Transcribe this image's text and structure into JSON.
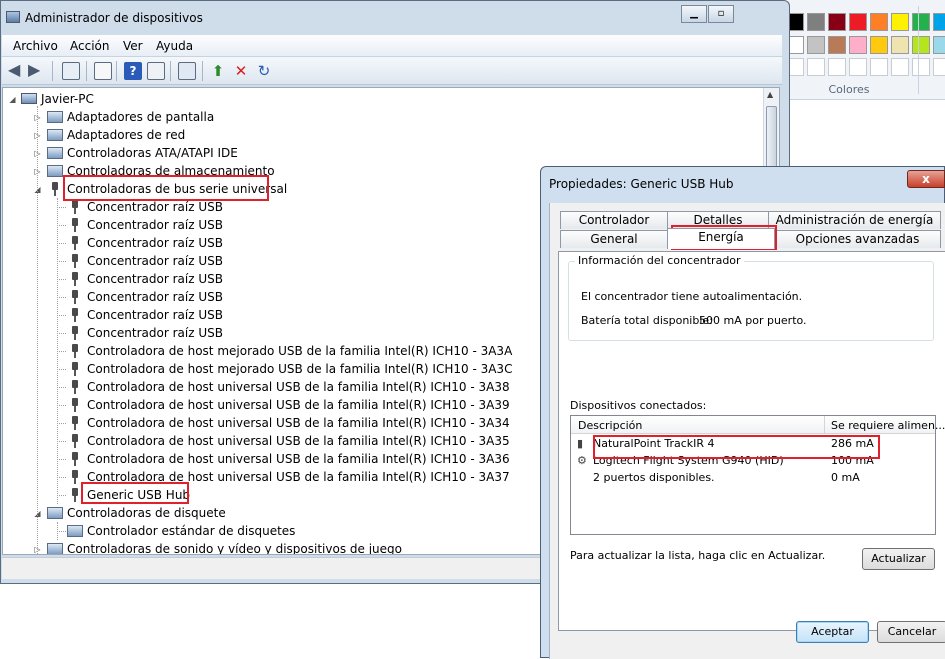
{
  "paint": {
    "colors_label": "Colores",
    "swatches_row1": [
      "#000000",
      "#7f7f7f",
      "#880015",
      "#ed1c24",
      "#ff7f27",
      "#fff200",
      "#22b14c",
      "#00a2e8"
    ],
    "swatches_row2": [
      "#ffffff",
      "#c3c3c3",
      "#b97a57",
      "#ffaec9",
      "#ffc90e",
      "#efe4b0",
      "#b5e61d",
      "#99d9ea"
    ]
  },
  "device_manager": {
    "title": "Administrador de dispositivos",
    "menu": [
      "Archivo",
      "Acción",
      "Ver",
      "Ayuda"
    ],
    "root": "Javier-PC",
    "tree": [
      {
        "label": "Adaptadores de pantalla",
        "level": 1,
        "icon": "monitor-icon",
        "expanded": false
      },
      {
        "label": "Adaptadores de red",
        "level": 1,
        "icon": "network-icon",
        "expanded": false
      },
      {
        "label": "Controladoras ATA/ATAPI IDE",
        "level": 1,
        "icon": "ide-icon",
        "expanded": false
      },
      {
        "label": "Controladoras de almacenamiento",
        "level": 1,
        "icon": "storage-icon",
        "expanded": false
      },
      {
        "label": "Controladoras de bus serie universal",
        "level": 1,
        "icon": "usb-icon",
        "expanded": true
      },
      {
        "label": "Concentrador raíz USB",
        "level": 2,
        "icon": "usb-icon"
      },
      {
        "label": "Concentrador raíz USB",
        "level": 2,
        "icon": "usb-icon"
      },
      {
        "label": "Concentrador raíz USB",
        "level": 2,
        "icon": "usb-icon"
      },
      {
        "label": "Concentrador raíz USB",
        "level": 2,
        "icon": "usb-icon"
      },
      {
        "label": "Concentrador raíz USB",
        "level": 2,
        "icon": "usb-icon"
      },
      {
        "label": "Concentrador raíz USB",
        "level": 2,
        "icon": "usb-icon"
      },
      {
        "label": "Concentrador raíz USB",
        "level": 2,
        "icon": "usb-icon"
      },
      {
        "label": "Concentrador raíz USB",
        "level": 2,
        "icon": "usb-icon"
      },
      {
        "label": "Controladora de host mejorado USB de la familia Intel(R) ICH10 - 3A3A",
        "level": 2,
        "icon": "usb-icon"
      },
      {
        "label": "Controladora de host mejorado USB de la familia Intel(R) ICH10 - 3A3C",
        "level": 2,
        "icon": "usb-icon"
      },
      {
        "label": "Controladora de host universal USB de la familia Intel(R) ICH10 - 3A38",
        "level": 2,
        "icon": "usb-icon"
      },
      {
        "label": "Controladora de host universal USB de la familia Intel(R) ICH10 - 3A39",
        "level": 2,
        "icon": "usb-icon"
      },
      {
        "label": "Controladora de host universal USB de la familia Intel(R) ICH10 - 3A34",
        "level": 2,
        "icon": "usb-icon"
      },
      {
        "label": "Controladora de host universal USB de la familia Intel(R) ICH10 - 3A35",
        "level": 2,
        "icon": "usb-icon"
      },
      {
        "label": "Controladora de host universal USB de la familia Intel(R) ICH10 - 3A36",
        "level": 2,
        "icon": "usb-icon"
      },
      {
        "label": "Controladora de host universal USB de la familia Intel(R) ICH10 - 3A37",
        "level": 2,
        "icon": "usb-icon"
      },
      {
        "label": "Generic USB Hub",
        "level": 2,
        "icon": "usb-icon"
      },
      {
        "label": "Controladoras de disquete",
        "level": 1,
        "icon": "floppy-controller-icon",
        "expanded": true
      },
      {
        "label": "Controlador estándar de disquetes",
        "level": 2,
        "icon": "floppy-icon"
      },
      {
        "label": "Controladoras de sonido y vídeo y dispositivos de juego",
        "level": 1,
        "icon": "sound-icon",
        "expanded": false
      }
    ]
  },
  "properties": {
    "title": "Propiedades: Generic USB Hub",
    "close_label": "x",
    "tabs_row1": [
      "Controlador",
      "Detalles",
      "Administración de energía"
    ],
    "tabs_row2": [
      "General",
      "Energía",
      "Opciones avanzadas"
    ],
    "hub_group_title": "Información del concentrador",
    "self_powered_text": "El concentrador tiene autoalimentación.",
    "battery_label": "Batería total disponible:",
    "battery_value": "500 mA por puerto.",
    "connected_label": "Dispositivos conectados:",
    "columns": [
      "Descripción",
      "Se requiere alimen..."
    ],
    "devices": [
      {
        "name": "NaturalPoint TrackIR 4",
        "power": "286 mA",
        "icon": "usb-plug-icon"
      },
      {
        "name": "Logitech Flight System G940 (HID)",
        "power": "100 mA",
        "icon": "joystick-icon"
      },
      {
        "name": "2 puertos disponibles.",
        "power": "0 mA",
        "icon": ""
      }
    ],
    "refresh_hint": "Para actualizar la lista, haga clic en Actualizar.",
    "refresh_button": "Actualizar",
    "ok_button": "Aceptar",
    "cancel_button": "Cancelar"
  }
}
